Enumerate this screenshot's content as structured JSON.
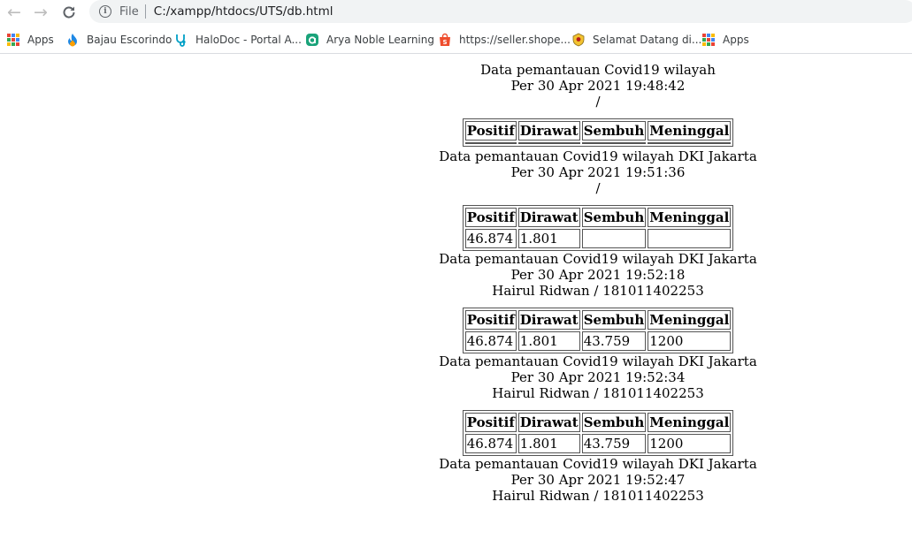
{
  "browser": {
    "scheme_label": "File",
    "url": "C:/xampp/htdocs/UTS/db.html",
    "bookmarks": [
      {
        "label": "Apps",
        "icon": "apps-grid-icon"
      },
      {
        "label": "Bajau Escorindo",
        "icon": "flame-icon"
      },
      {
        "label": "HaloDoc - Portal A...",
        "icon": "stethoscope-icon"
      },
      {
        "label": "Arya Noble Learning",
        "icon": "arya-logo-icon"
      },
      {
        "label": "https://seller.shope...",
        "icon": "shopee-bag-icon"
      },
      {
        "label": "Selamat Datang di...",
        "icon": "emblem-icon"
      },
      {
        "label": "Apps",
        "icon": "apps-grid-icon"
      }
    ]
  },
  "table_headers": [
    "Positif",
    "Dirawat",
    "Sembuh",
    "Meninggal"
  ],
  "intro": {
    "title": "Data pemantauan Covid19 wilayah",
    "timestamp": "Per 30 Apr 2021 19:48:42",
    "author": "/"
  },
  "blocks": [
    {
      "cells": null,
      "title": "Data pemantauan Covid19 wilayah DKI Jakarta",
      "timestamp": "Per 30 Apr 2021 19:51:36",
      "author": "/"
    },
    {
      "cells": [
        "46.874",
        "1.801",
        "",
        ""
      ],
      "title": "Data pemantauan Covid19 wilayah DKI Jakarta",
      "timestamp": "Per 30 Apr 2021 19:52:18",
      "author": "Hairul Ridwan / 181011402253"
    },
    {
      "cells": [
        "46.874",
        "1.801",
        "43.759",
        "1200"
      ],
      "title": "Data pemantauan Covid19 wilayah DKI Jakarta",
      "timestamp": "Per 30 Apr 2021 19:52:34",
      "author": "Hairul Ridwan / 181011402253"
    },
    {
      "cells": [
        "46.874",
        "1.801",
        "43.759",
        "1200"
      ],
      "title": "Data pemantauan Covid19 wilayah DKI Jakarta",
      "timestamp": "Per 30 Apr 2021 19:52:47",
      "author": "Hairul Ridwan / 181011402253"
    }
  ],
  "colors": {
    "apps_grid": [
      "#ea4335",
      "#4285f4",
      "#fbbc05",
      "#34a853",
      "#ea4335",
      "#4285f4",
      "#fbbc05",
      "#34a853",
      "#ea4335"
    ]
  }
}
